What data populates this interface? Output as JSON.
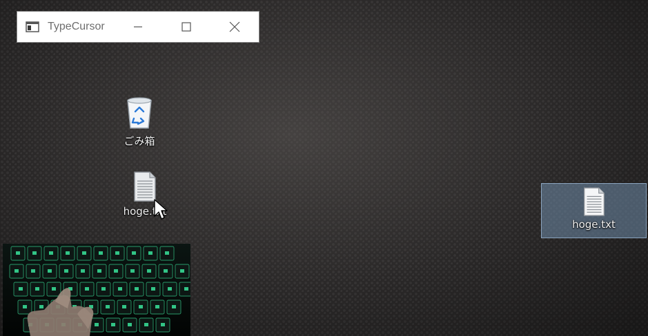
{
  "app_window": {
    "title": "TypeCursor",
    "icon": "app-window-icon",
    "buttons": {
      "minimize": "minimize-icon",
      "maximize": "maximize-icon",
      "close": "close-icon"
    }
  },
  "desktop": {
    "icons": [
      {
        "label": "ごみ箱",
        "icon": "recycle-bin-icon"
      },
      {
        "label": "hoge.txt",
        "icon": "text-file-icon"
      }
    ],
    "selected_item": {
      "label": "hoge.txt",
      "icon": "text-file-icon"
    }
  },
  "overlay": {
    "keyboard": {
      "icon": "keyboard-video-overlay",
      "key_glow": "#39e39a"
    }
  },
  "colors": {
    "wallpaper": "#2a2828",
    "selection": "#708caa",
    "label_text": "#f2f2f2"
  }
}
